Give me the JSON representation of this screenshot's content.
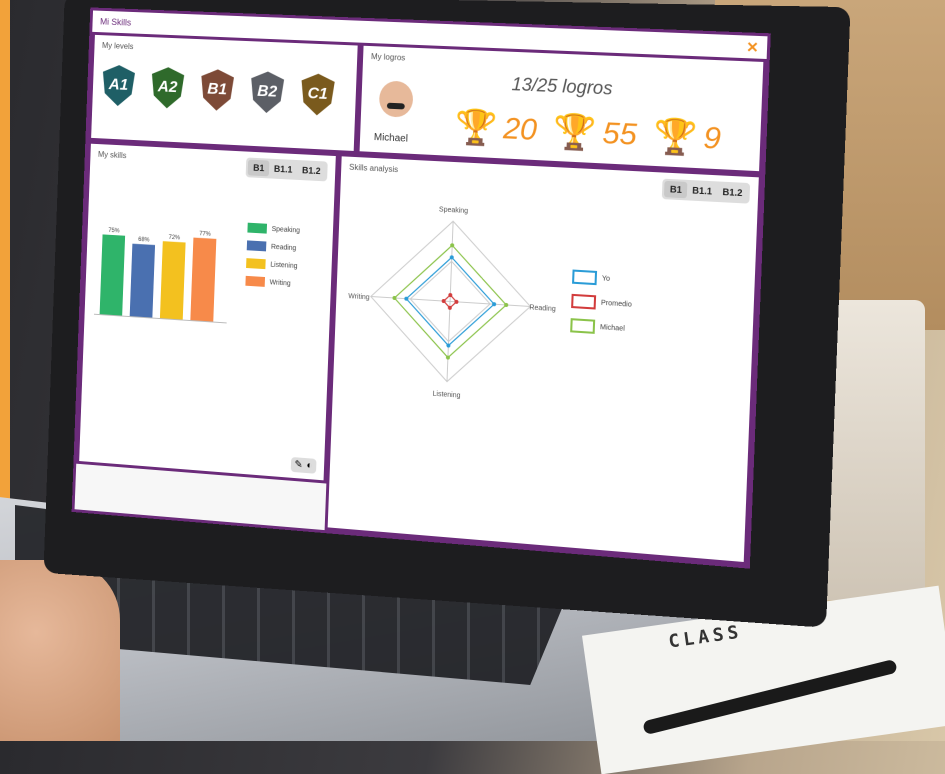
{
  "window": {
    "title": "Mi Skills",
    "close_label": "✕"
  },
  "levels_panel": {
    "title": "My levels",
    "levels": [
      {
        "label": "A1",
        "color": "#1f5f66"
      },
      {
        "label": "A2",
        "color": "#2f6a2b"
      },
      {
        "label": "B1",
        "color": "#7d4a37"
      },
      {
        "label": "B2",
        "color": "#5c5f66"
      },
      {
        "label": "C1",
        "color": "#7a5a1d"
      }
    ]
  },
  "achievements_panel": {
    "title": "My logros",
    "heading": "13/25 logros",
    "user_name": "Michael",
    "trophies": [
      {
        "icon": "gold-trophy-icon",
        "glyph": "🏆",
        "count": "20",
        "color": "#e0b13a"
      },
      {
        "icon": "silver-trophy-icon",
        "glyph": "🏆",
        "count": "55",
        "color": "#9a9a9a"
      },
      {
        "icon": "bronze-trophy-icon",
        "glyph": "🏆",
        "count": "9",
        "color": "#b4633a"
      }
    ]
  },
  "skills_panel": {
    "title": "My skills",
    "tabs": [
      "B1",
      "B1.1",
      "B1.2"
    ],
    "active_tab": "B1",
    "chart_data": {
      "type": "bar",
      "categories": [
        "Speaking",
        "Reading",
        "Listening",
        "Writing"
      ],
      "values": [
        75,
        68,
        72,
        77
      ],
      "data_labels": [
        "75%",
        "68%",
        "72%",
        "77%"
      ],
      "colors": [
        "#2fb46a",
        "#4a70b0",
        "#f3c11f",
        "#f78a4a"
      ],
      "ylim": [
        0,
        100
      ]
    },
    "footer_buttons": [
      "✎",
      "◐"
    ]
  },
  "analysis_panel": {
    "title": "Skills analysis",
    "tabs": [
      "B1",
      "B1.1",
      "B1.2"
    ],
    "active_tab": "B1",
    "chart_data": {
      "type": "radar",
      "axes": [
        "Speaking",
        "Reading",
        "Listening",
        "Writing"
      ],
      "series": [
        {
          "name": "Yo",
          "values": [
            55,
            55,
            55,
            55
          ],
          "color": "#2a9cd7"
        },
        {
          "name": "Promedio",
          "values": [
            8,
            8,
            8,
            8
          ],
          "color": "#d23c3c"
        },
        {
          "name": "Michael",
          "values": [
            70,
            70,
            70,
            70
          ],
          "color": "#8bc34a"
        }
      ]
    }
  },
  "background": {
    "paper_text": "CLASS"
  }
}
